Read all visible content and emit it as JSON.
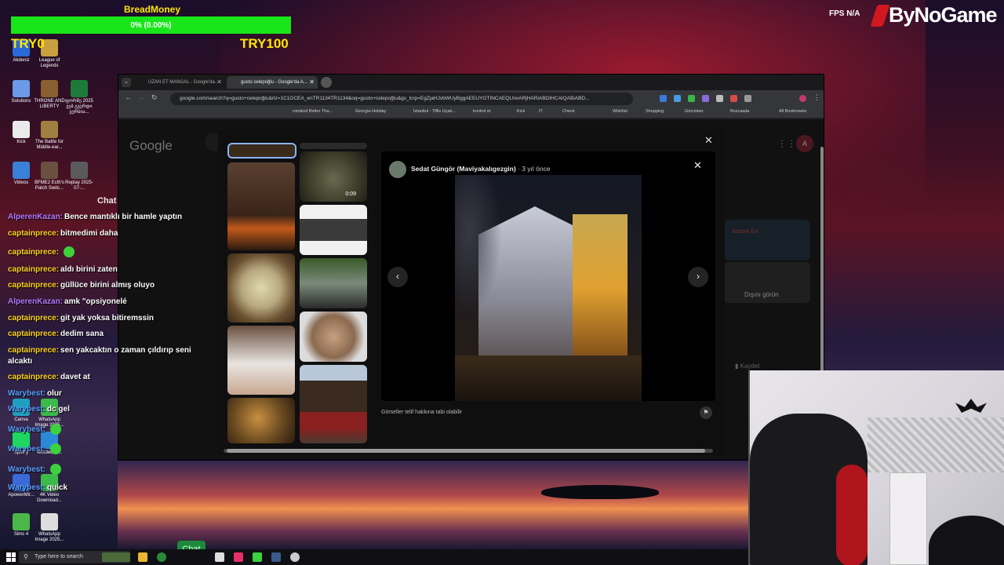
{
  "money": {
    "title": "BreadMoney",
    "percent": "0% (0.00%)",
    "low": "TRY0",
    "high": "TRY100",
    "progress_fraction": 0
  },
  "hud": {
    "fps_label": "FPS",
    "fps_value": "N/A",
    "brand": "ByNoGame"
  },
  "desktop_icons": [
    {
      "label": "Akdeniz"
    },
    {
      "label": "League of Legends"
    },
    {
      "label": "Solutions"
    },
    {
      "label": "THRONE AND LIBERTY"
    },
    {
      "label": "ფორმე 2025 ვებ გვერდი ვერსია..."
    },
    {
      "label": "Kick"
    },
    {
      "label": "The Battle for Middle-ear..."
    },
    {
      "label": "Videos"
    },
    {
      "label": "BFME2 Ecth's Patch Switc..."
    },
    {
      "label": "Replay 2025-07-..."
    },
    {
      "label": "Canva"
    },
    {
      "label": "WhatsApp Image 2025..."
    },
    {
      "label": "Spotify"
    },
    {
      "label": "4kvideodo..."
    },
    {
      "label": "ApowerMir..."
    },
    {
      "label": "4K Video Download..."
    },
    {
      "label": "Sims 4"
    },
    {
      "label": "WhatsApp Image 2025..."
    }
  ],
  "chat": {
    "title": "Chat",
    "messages": [
      {
        "user": "AlperenKazan:",
        "text": "Bence mantıklı bir hamle yaptın",
        "color": "#b478ff"
      },
      {
        "user": "captainprece:",
        "text": "bitmedimi daha",
        "color": "#ffd21e"
      },
      {
        "user": "captainprece:",
        "text": "",
        "color": "#ffd21e"
      },
      {
        "user": "captainprece:",
        "text": "aldı birini zaten",
        "color": "#ffd21e"
      },
      {
        "user": "captainprece:",
        "text": "güllüce birini almış oluyo",
        "color": "#ffd21e"
      },
      {
        "user": "AlperenKazan:",
        "text": "amk \"opsiyonelé",
        "color": "#b478ff"
      },
      {
        "user": "captainprece:",
        "text": "git yak yoksa bitiremssin",
        "color": "#ffd21e"
      },
      {
        "user": "captainprece:",
        "text": "dedim sana",
        "color": "#ffd21e"
      },
      {
        "user": "captainprece:",
        "text": "sen yakcaktın o zaman çıldırıp seni alcaktı",
        "color": "#ffd21e"
      },
      {
        "user": "captainprece:",
        "text": "davet at",
        "color": "#ffd21e"
      },
      {
        "user": "Warybest:",
        "text": "olur",
        "color": "#5aa0ff"
      },
      {
        "user": "Warybest:",
        "text": "dc gel",
        "color": "#5aa0ff"
      },
      {
        "user": "Warybest:",
        "text": "",
        "color": "#5aa0ff"
      },
      {
        "user": "Warybest:",
        "text": "",
        "color": "#5aa0ff"
      },
      {
        "user": "Warybest:",
        "text": "",
        "color": "#5aa0ff"
      },
      {
        "user": "Warybest:",
        "text": "quick",
        "color": "#5aa0ff"
      }
    ]
  },
  "browser": {
    "tabs": [
      {
        "label": "UZAN ET MANGAL - Google'da..."
      },
      {
        "label": "gusto celepoğlu - Google'da A..."
      }
    ],
    "url": "google.com/search?q=gusto+celepoğlu&rlz=1C1GCEA_enTR1134TR1134&oq=gusto+celepoğlu&gs_lcrp=EgZjaHJvbWUyBggAEEUYOTINCAEQLhivARjHARiABDIHCAIQABiABD...",
    "bookmarks": [
      "rom&nd Better Tha...",
      "Georgia Holiday",
      "İstanbul - Tiflis Uçak...",
      "kontrol et",
      "Kick",
      "IT",
      "Check",
      "Wishlist",
      "Shopping",
      "Gürcistan",
      "Bozcaada",
      "All Bookmarks"
    ],
    "google_logo": "Google",
    "side_text": {
      "dis_gorun": "Dışını görün",
      "kaydet": "Kaydet",
      "ataturk_evi": "Atatürk Evi"
    },
    "lightbox": {
      "video_time": "0:09",
      "author": "Sedat Güngör (Maviyakalıgezgin)",
      "time_ago": "· 3 yıl önce",
      "copyright": "Görseller telif hakkına tabi olabilir"
    }
  },
  "taskbar": {
    "search_placeholder": "Type here to search",
    "chat_button": "Chat"
  },
  "colors": {
    "money_bar": "#19e619",
    "money_text": "#ffe600",
    "brand_red": "#d01820"
  }
}
